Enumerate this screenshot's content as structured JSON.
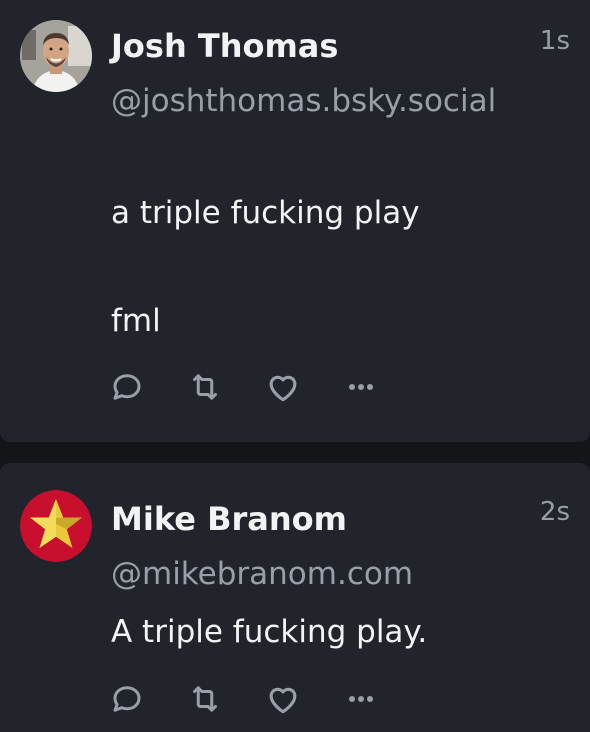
{
  "posts": [
    {
      "author_name": "Josh Thomas",
      "handle": "@joshthomas.bsky.social",
      "time": "1s",
      "text": "a triple fucking play\n\nfml",
      "actions": [
        "reply-icon",
        "repost-icon",
        "like-icon",
        "more-icon"
      ]
    },
    {
      "author_name": "Mike Branom",
      "handle": "@mikebranom.com",
      "time": "2s",
      "text": "A triple fucking play.",
      "actions": [
        "reply-icon",
        "repost-icon",
        "like-icon",
        "more-icon"
      ]
    }
  ],
  "colors": {
    "background": "#141519",
    "card": "#22242b",
    "text_primary": "#f1f3f5",
    "text_secondary": "#9a9ea8",
    "avatar2_bg": "#c8102e",
    "avatar2_star": "#e8c93a"
  }
}
